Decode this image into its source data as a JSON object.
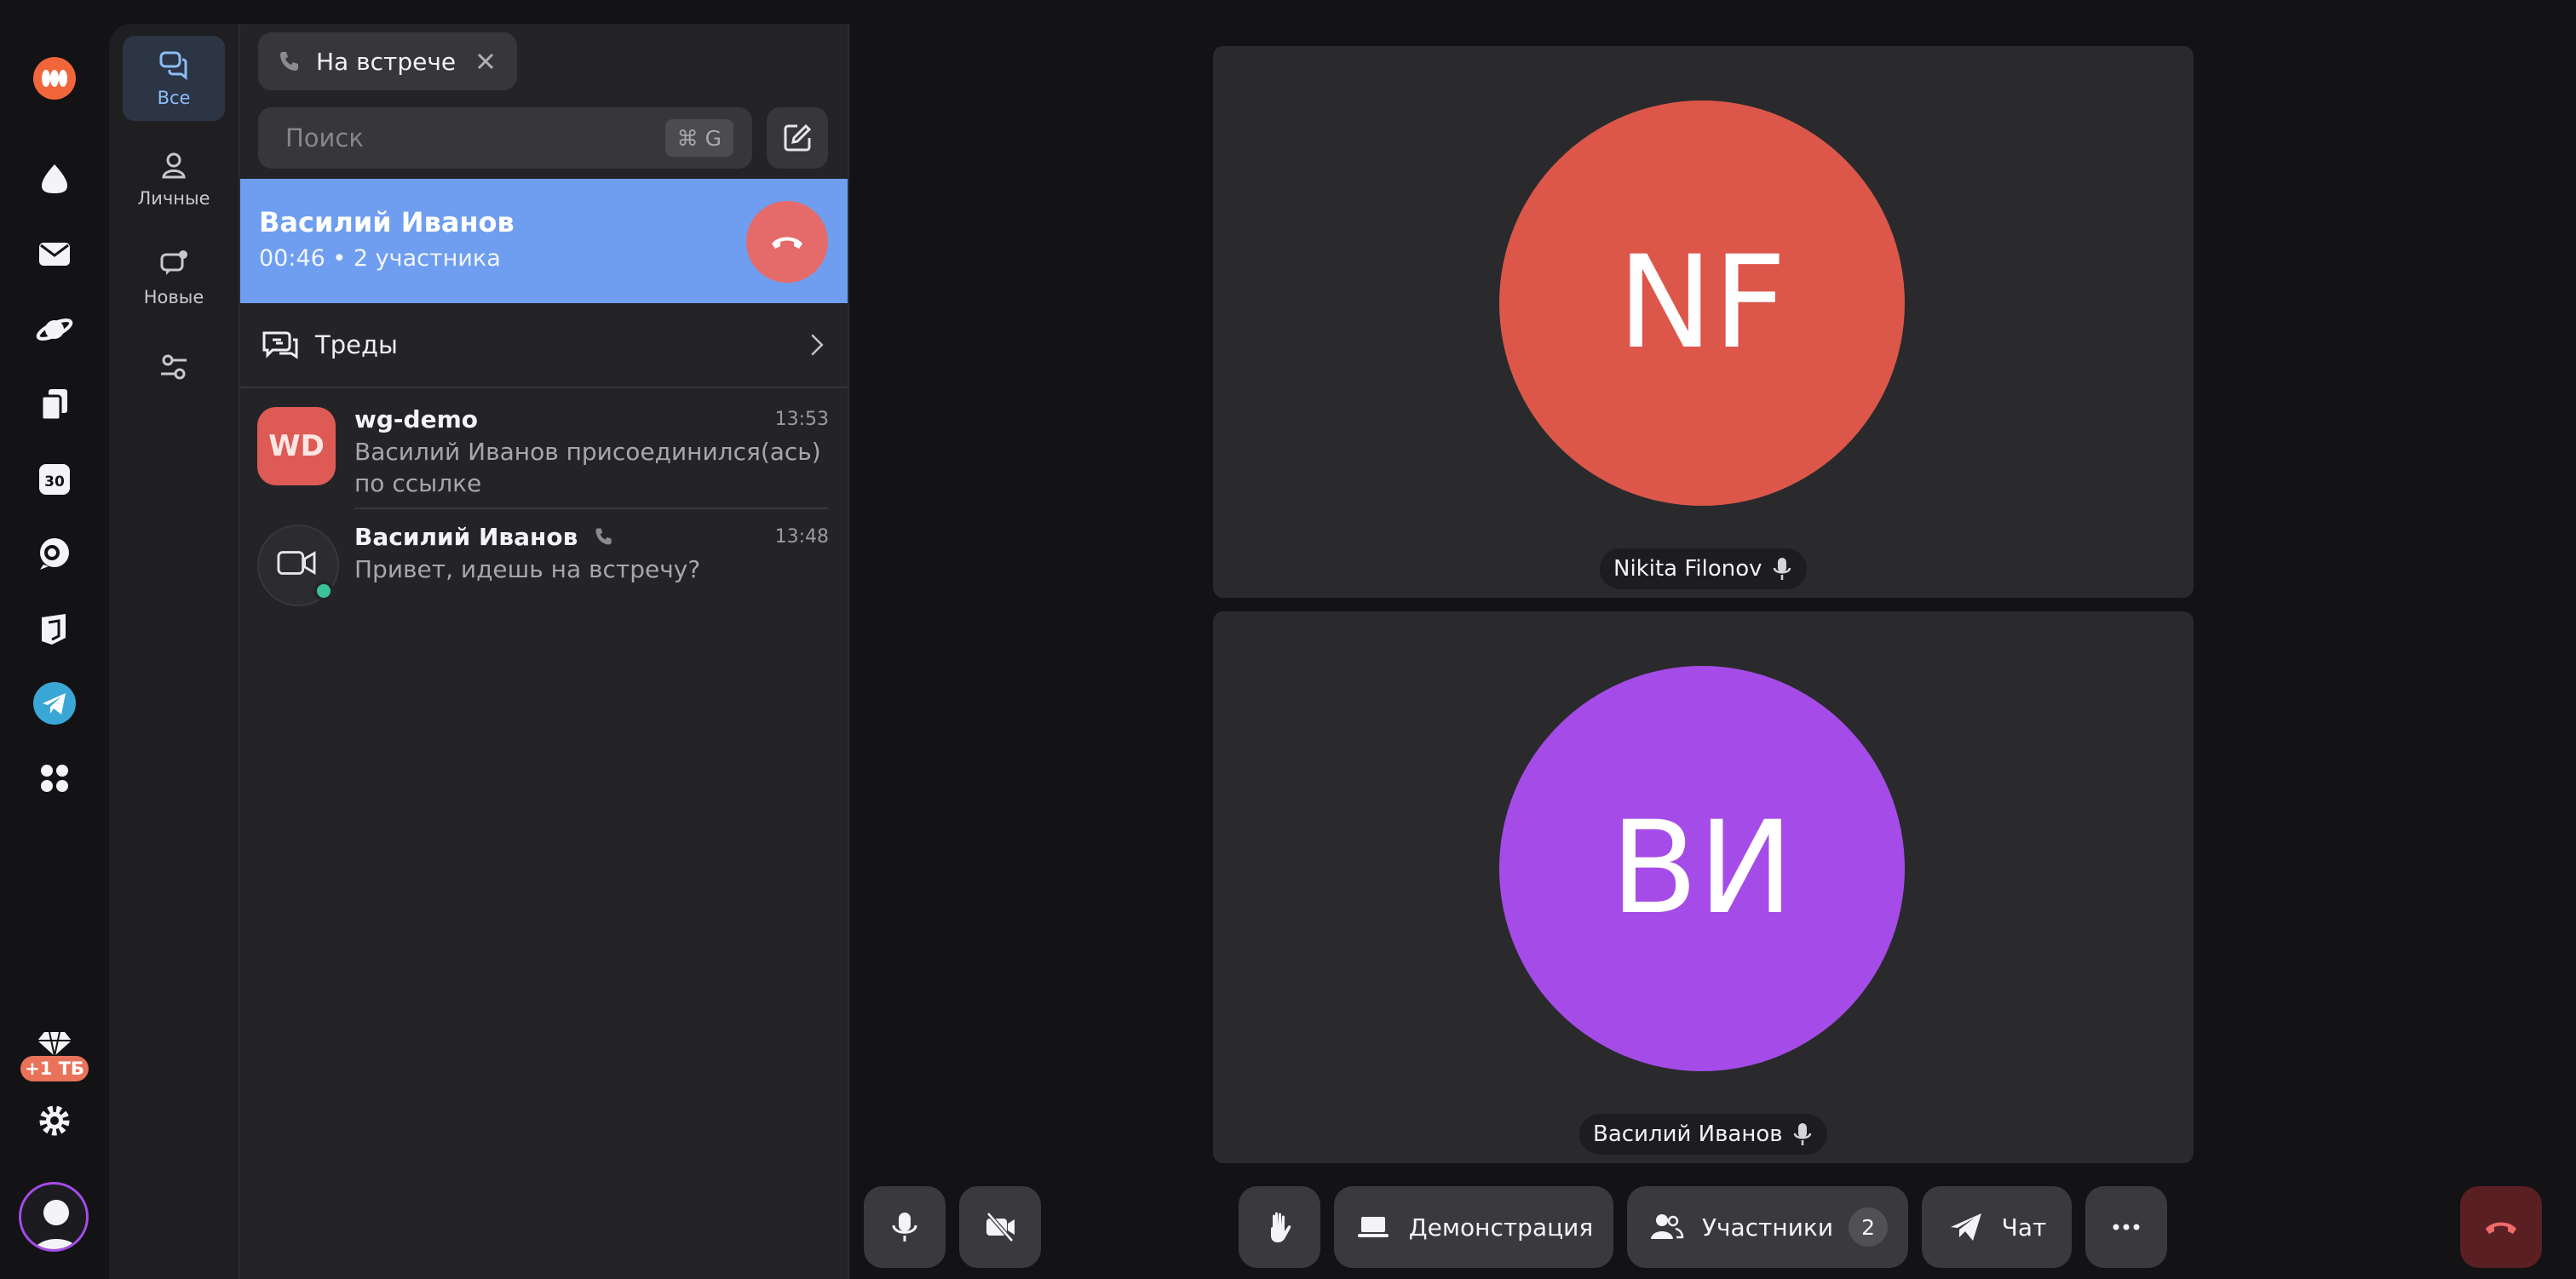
{
  "rail": {
    "items": [
      "messenger-logo-icon",
      "drop-icon",
      "mail-icon",
      "planet-icon",
      "documents-icon",
      "calendar-icon",
      "tracker-icon",
      "forms-icon",
      "telegram-icon",
      "apps-grid-icon"
    ],
    "calendar_day": "30",
    "storage_badge": "+1 ТБ"
  },
  "folders": [
    {
      "label": "Все",
      "active": true
    },
    {
      "label": "Личные",
      "active": false
    },
    {
      "label": "Новые",
      "active": false
    }
  ],
  "meeting_chip": {
    "label": "На встрече"
  },
  "search": {
    "placeholder": "Поиск",
    "shortcut": "⌘ G"
  },
  "active_call": {
    "name": "Василий Иванов",
    "status": "00:46 • 2 участника"
  },
  "threads": {
    "label": "Треды"
  },
  "chats": [
    {
      "avatar_text": "WD",
      "title": "wg-demo",
      "time": "13:53",
      "message": "Василий Иванов присоединился(ась) по ссылке"
    },
    {
      "avatar_text": "",
      "title": "Василий Иванов",
      "time": "13:48",
      "message": "Привет, идешь на встречу?"
    }
  ],
  "participants": [
    {
      "initials": "NF",
      "name": "Nikita Filonov",
      "color": "#dc574a"
    },
    {
      "initials": "ВИ",
      "name": "Василий Иванов",
      "color": "#a54ce8"
    }
  ],
  "controls": {
    "screen_share": "Демонстрация",
    "participants": "Участники",
    "participants_count": "2",
    "chat": "Чат"
  },
  "colors": {
    "accent": "#6f9ef0",
    "hangup": "#e56b6b",
    "end_call": "#5a1f22"
  }
}
